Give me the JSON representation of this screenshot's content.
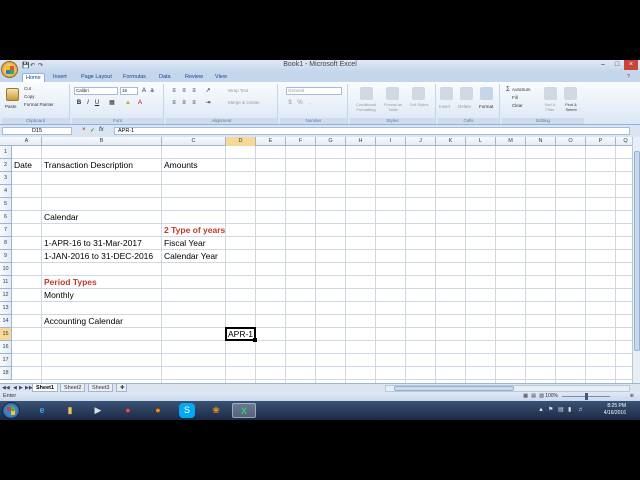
{
  "window": {
    "title": "Book1 - Microsoft Excel"
  },
  "ribbon": {
    "tabs": [
      "Home",
      "Insert",
      "Page Layout",
      "Formulas",
      "Data",
      "Review",
      "View"
    ],
    "active_tab": "Home",
    "clipboard": {
      "paste": "Paste",
      "cut": "Cut",
      "copy": "Copy",
      "format_painter": "Format Painter",
      "label": "Clipboard"
    },
    "font": {
      "name": "Calibri",
      "size": "16",
      "label": "Font"
    },
    "alignment": {
      "wrap": "Wrap Text",
      "merge": "Merge & Center",
      "label": "Alignment"
    },
    "number": {
      "format": "General",
      "label": "Number"
    },
    "styles": {
      "cond": "Conditional Formatting",
      "table": "Format as Table",
      "cell": "Cell Styles",
      "label": "Styles"
    },
    "cells": {
      "insert": "Insert",
      "delete": "Delete",
      "format": "Format",
      "label": "Cells"
    },
    "editing": {
      "autosum": "AutoSum",
      "fill": "Fill",
      "clear": "Clear",
      "sort": "Sort & Filter",
      "find": "Find & Select",
      "label": "Editing"
    }
  },
  "formula_bar": {
    "name_box": "D15",
    "fx": "fx",
    "content": "APR-1"
  },
  "grid": {
    "columns": [
      "A",
      "B",
      "C",
      "D",
      "E",
      "F",
      "G",
      "H",
      "I",
      "J",
      "K",
      "L",
      "M",
      "N",
      "O",
      "P",
      "Q"
    ],
    "rows": [
      "1",
      "2",
      "3",
      "4",
      "5",
      "6",
      "7",
      "8",
      "9",
      "10",
      "11",
      "12",
      "13",
      "14",
      "15",
      "16",
      "17",
      "18"
    ],
    "selected_column": "D",
    "selected_row": "15",
    "cells": {
      "A2": "Date",
      "B2": "Transaction Description",
      "C2": "Amounts",
      "B6": "Calendar",
      "C7": "2 Type of years",
      "B8": "1-APR-16 to 31-Mar-2017",
      "C8": "Fiscal Year",
      "B9": "1-JAN-2016 to 31-DEC-2016",
      "C9": "Calendar Year",
      "B11": "Period Types",
      "B12": "Monthly",
      "B14": "Accounting Calendar",
      "D15": "APR-1"
    },
    "red_bold_color": "#c0392b"
  },
  "sheets": {
    "tabs": [
      "Sheet1",
      "Sheet2",
      "Sheet3"
    ],
    "active": "Sheet1"
  },
  "status": {
    "mode": "Enter",
    "zoom": "100%"
  },
  "taskbar": {
    "time": "8:25 PM",
    "date": "4/16/2016"
  }
}
